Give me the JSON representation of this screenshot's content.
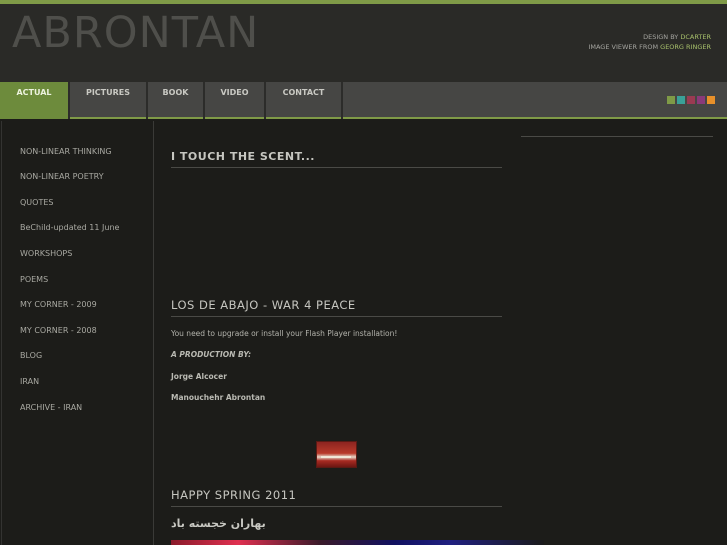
{
  "header": {
    "site_title": "ABRONTAN",
    "credit_design_prefix": "DESIGN BY",
    "credit_design_name": "DCARTER",
    "credit_viewer_prefix": "IMAGE VIEWER FROM",
    "credit_viewer_name": "GEORG RINGER"
  },
  "nav": {
    "tabs": [
      {
        "label": "ACTUAL",
        "active": true
      },
      {
        "label": "PICTURES",
        "active": false
      },
      {
        "label": "BOOK",
        "active": false
      },
      {
        "label": "VIDEO",
        "active": false
      },
      {
        "label": "CONTACT",
        "active": false
      }
    ],
    "swatches": [
      "#7f9a47",
      "#3aa098",
      "#9a3a52",
      "#8a3a7a",
      "#e8902a"
    ]
  },
  "sidebar": {
    "items": [
      {
        "label": "NON-LINEAR THINKING"
      },
      {
        "label": "NON-LINEAR POETRY"
      },
      {
        "label": "QUOTES"
      },
      {
        "label": "BeChild-updated 11 June"
      },
      {
        "label": "WORKSHOPS"
      },
      {
        "label": "POEMS"
      },
      {
        "label": "MY CORNER - 2009"
      },
      {
        "label": "MY CORNER - 2008"
      },
      {
        "label": "BLOG"
      },
      {
        "label": "IRAN"
      },
      {
        "label": "ARCHIVE - IRAN"
      }
    ]
  },
  "main": {
    "post1_title": "I TOUCH THE SCENT...",
    "post2_title": "LOS DE ABAJO - WAR 4 PEACE",
    "post2_flash_msg": "You need to upgrade or install your Flash Player installation!",
    "post2_production": "A PRODUCTION BY:",
    "post2_credit1": "Jorge Alcocer",
    "post2_credit2": "Manouchehr Abrontan",
    "post3_title": "HAPPY SPRING 2011",
    "post3_farsi": "بهاران خجسته باد"
  },
  "colors": {
    "accent": "#7f9a47",
    "background": "#1c1c19"
  }
}
